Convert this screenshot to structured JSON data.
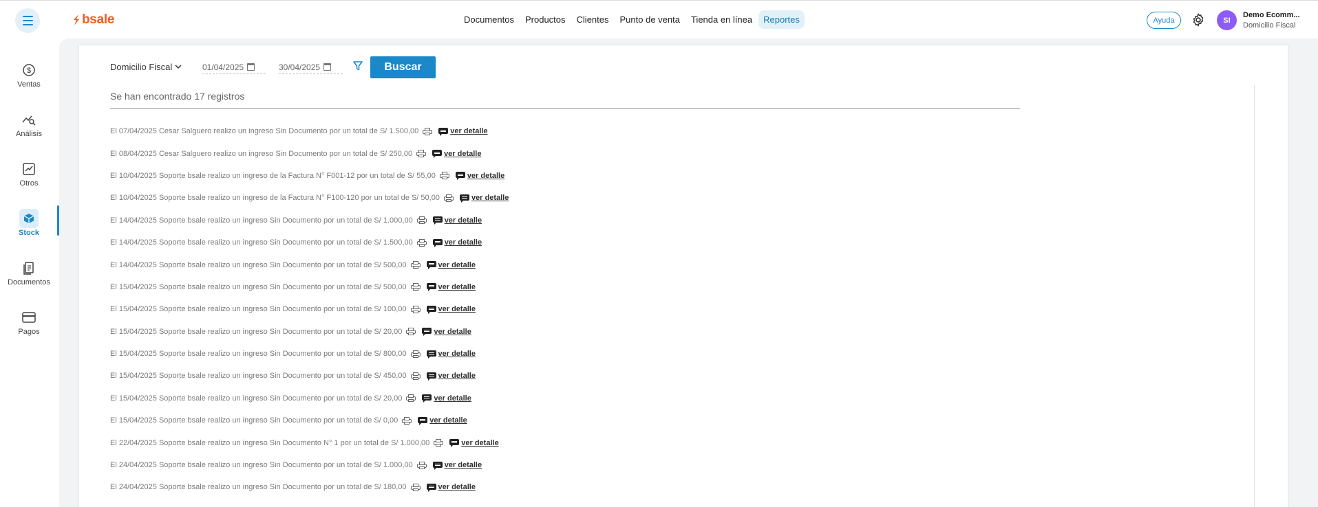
{
  "header": {
    "logo_text": "bsale",
    "nav": [
      {
        "label": "Documentos",
        "active": false
      },
      {
        "label": "Productos",
        "active": false
      },
      {
        "label": "Clientes",
        "active": false
      },
      {
        "label": "Punto de venta",
        "active": false
      },
      {
        "label": "Tienda en línea",
        "active": false
      },
      {
        "label": "Reportes",
        "active": true
      }
    ],
    "help_label": "Ayuda",
    "user": {
      "initials": "SI",
      "name": "Demo Ecomm...",
      "branch": "Domicilio Fiscal"
    }
  },
  "sidebar": {
    "items": [
      {
        "label": "Ventas",
        "icon": "dollar-circle-icon",
        "active": false
      },
      {
        "label": "Análisis",
        "icon": "trend-search-icon",
        "active": false
      },
      {
        "label": "Otros",
        "icon": "chart-box-icon",
        "active": false
      },
      {
        "label": "Stock",
        "icon": "box-icon",
        "active": true
      },
      {
        "label": "Documentos",
        "icon": "documents-icon",
        "active": false
      },
      {
        "label": "Pagos",
        "icon": "card-icon",
        "active": false
      }
    ]
  },
  "filters": {
    "branch": "Domicilio Fiscal",
    "date_from": "01/04/2025",
    "date_to": "30/04/2025",
    "search_label": "Buscar"
  },
  "results": {
    "count_text": "Se han encontrado 17 registros",
    "detail_label": "ver detalle",
    "records": [
      "El 07/04/2025 Cesar Salguero realizo un ingreso Sin Documento por un total de S/ 1.500,00",
      "El 08/04/2025 Cesar Salguero realizo un ingreso Sin Documento por un total de S/ 250,00",
      "El 10/04/2025 Soporte bsale realizo un ingreso de la Factura N° F001-12 por un total de S/ 55,00",
      "El 10/04/2025 Soporte bsale realizo un ingreso de la Factura N° F100-120 por un total de S/ 50,00",
      "El 14/04/2025 Soporte bsale realizo un ingreso Sin Documento por un total de S/ 1.000,00",
      "El 14/04/2025 Soporte bsale realizo un ingreso Sin Documento por un total de S/ 1.500,00",
      "El 14/04/2025 Soporte bsale realizo un ingreso Sin Documento por un total de S/ 500,00",
      "El 15/04/2025 Soporte bsale realizo un ingreso Sin Documento por un total de S/ 500,00",
      "El 15/04/2025 Soporte bsale realizo un ingreso Sin Documento por un total de S/ 100,00",
      "El 15/04/2025 Soporte bsale realizo un ingreso Sin Documento por un total de S/ 20,00",
      "El 15/04/2025 Soporte bsale realizo un ingreso Sin Documento por un total de S/ 800,00",
      "El 15/04/2025 Soporte bsale realizo un ingreso Sin Documento por un total de S/ 450,00",
      "El 15/04/2025 Soporte bsale realizo un ingreso Sin Documento por un total de S/ 20,00",
      "El 15/04/2025 Soporte bsale realizo un ingreso Sin Documento por un total de S/ 0,00",
      "El 22/04/2025 Soporte bsale realizo un ingreso Sin Documento N° 1 por un total de S/ 1.000,00",
      "El 24/04/2025 Soporte bsale realizo un ingreso Sin Documento por un total de S/ 1.000,00",
      "El 24/04/2025 Soporte bsale realizo un ingreso Sin Documento por un total de S/ 180,00"
    ]
  },
  "colors": {
    "accent": "#1b88c8",
    "brand": "#f25c22",
    "avatar": "#8b5cf6"
  }
}
